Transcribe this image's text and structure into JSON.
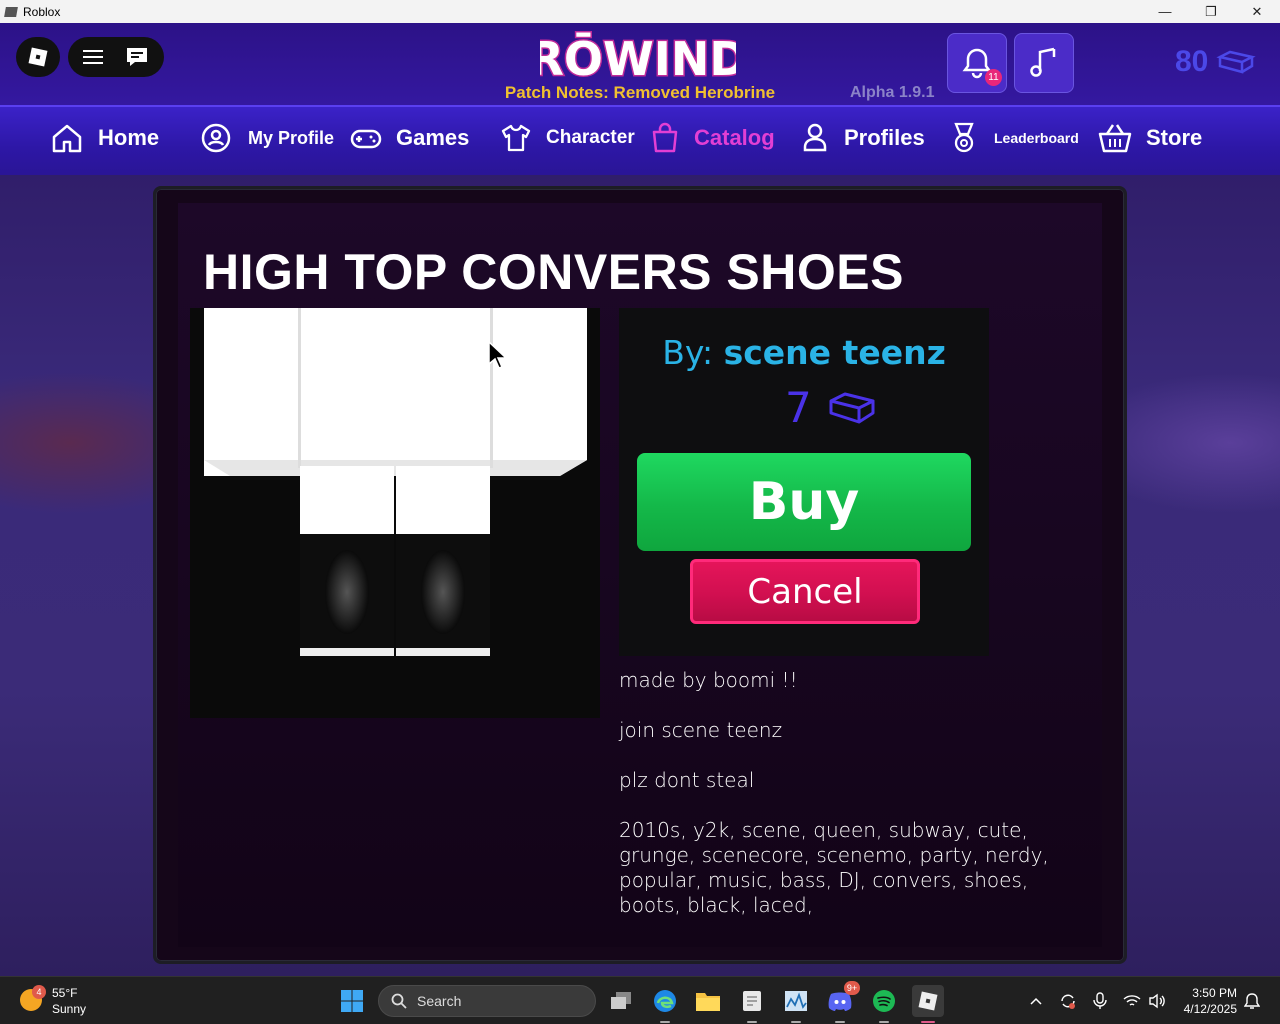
{
  "window": {
    "title": "Roblox",
    "controls": {
      "minimize": "—",
      "maximize": "❐",
      "close": "✕"
    }
  },
  "header": {
    "logo_text": "RŌWIND",
    "patch_notes": "Patch Notes: Removed Herobrine",
    "version": "Alpha 1.9.1",
    "notification_count": "11",
    "currency": "80"
  },
  "nav": {
    "home": "Home",
    "my_profile": "My Profile",
    "games": "Games",
    "character": "Character",
    "catalog": "Catalog",
    "profiles": "Profiles",
    "leaderboard": "Leaderboard",
    "store": "Store"
  },
  "item": {
    "title": "HIGH TOP CONVERS SHOES",
    "by_prefix": "By: ",
    "creator": "scene teenz",
    "price": "7",
    "buy_label": "Buy",
    "cancel_label": "Cancel",
    "description": [
      "made by boomi !!",
      "join scene teenz",
      "plz dont steal",
      "2010s, y2k, scene, queen, subway, cute, grunge, scenecore, scenemo, party, nerdy, popular, music, bass, DJ, convers, shoes, boots, black, laced,"
    ]
  },
  "taskbar": {
    "weather_badge": "4",
    "temperature": "55°F",
    "condition": "Sunny",
    "search_placeholder": "Search",
    "discord_badge": "9+",
    "time": "3:50 PM",
    "date": "4/12/2025"
  },
  "colors": {
    "accent_catalog": "#e23fd4",
    "buy_green": "#14b849",
    "cancel_red": "#d10f50",
    "creator_blue": "#2ab3e6",
    "price_purple": "#4a32e8"
  }
}
